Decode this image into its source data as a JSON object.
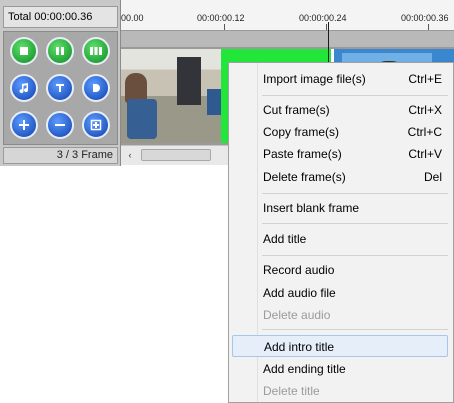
{
  "panel": {
    "total": "Total 00:00:00.36",
    "frame_count": "3 / 3 Frame"
  },
  "timeline": {
    "ticks": [
      "00.00",
      "00:00:00.12",
      "00:00:00.24",
      "00:00:00.36"
    ],
    "scroll_left_arrow": "‹"
  },
  "menu": {
    "import_image": {
      "label": "Import image file(s)",
      "shortcut": "Ctrl+E"
    },
    "cut_frame": {
      "label": "Cut frame(s)",
      "shortcut": "Ctrl+X"
    },
    "copy_frame": {
      "label": "Copy frame(s)",
      "shortcut": "Ctrl+C"
    },
    "paste_frame": {
      "label": "Paste frame(s)",
      "shortcut": "Ctrl+V"
    },
    "delete_frame": {
      "label": "Delete frame(s)",
      "shortcut": "Del"
    },
    "insert_blank": {
      "label": "Insert blank frame"
    },
    "add_title": {
      "label": "Add title"
    },
    "record_audio": {
      "label": "Record audio"
    },
    "add_audio_file": {
      "label": "Add audio file"
    },
    "delete_audio": {
      "label": "Delete audio"
    },
    "add_intro_title": {
      "label": "Add intro title"
    },
    "add_ending_title": {
      "label": "Add ending title"
    },
    "delete_title": {
      "label": "Delete title"
    }
  },
  "colors": {
    "green_button": "#0c8a23",
    "blue_button": "#0f3fae",
    "menu_highlight": "#e5eef9",
    "disabled_text": "#9b9b9b"
  }
}
